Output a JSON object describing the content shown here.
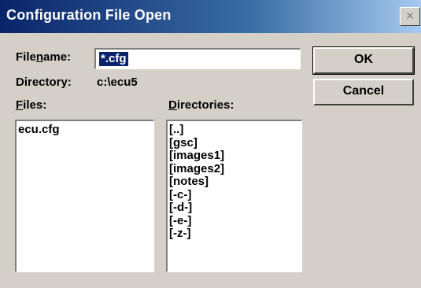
{
  "window": {
    "title": "Configuration File Open",
    "close_glyph": "×"
  },
  "form": {
    "filename_label_pre": "File",
    "filename_label_mnemonic": "n",
    "filename_label_post": "ame:",
    "filename_value": "*.cfg",
    "directory_label": "Directory:",
    "directory_value": "c:\\ecu5",
    "files_label_mnemonic": "F",
    "files_label_post": "iles:",
    "directories_label_mnemonic": "D",
    "directories_label_post": "irectories:"
  },
  "buttons": {
    "ok": "OK",
    "cancel": "Cancel"
  },
  "files": [
    "ecu.cfg"
  ],
  "directories": [
    "[..]",
    "[gsc]",
    "[images1]",
    "[images2]",
    "[notes]",
    "[-c-]",
    "[-d-]",
    "[-e-]",
    "[-z-]"
  ]
}
